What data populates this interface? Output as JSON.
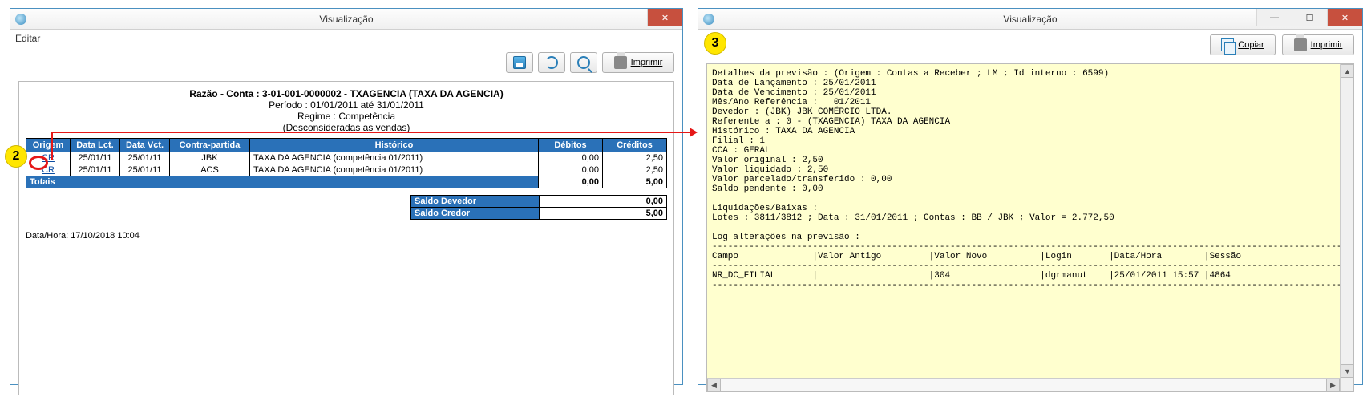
{
  "step_badges": {
    "two": "2",
    "three": "3"
  },
  "left": {
    "title": "Visualização",
    "menu_edit": "Editar",
    "btn_imprimir": "Imprimir",
    "report": {
      "l1": "Razão - Conta : 3-01-001-0000002 - TXAGENCIA (TAXA DA AGENCIA)",
      "l2": "Período : 01/01/2011 até 31/01/2011",
      "l3": "Regime : Competência",
      "l4": "(Desconsideradas as vendas)"
    },
    "cols": {
      "origem": "Origem",
      "data_lct": "Data Lct.",
      "data_vct": "Data Vct.",
      "contra": "Contra-partida",
      "historico": "Histórico",
      "debitos": "Débitos",
      "creditos": "Créditos"
    },
    "rows": [
      {
        "origem": "CR",
        "lct": "25/01/11",
        "vct": "25/01/11",
        "contra": "JBK",
        "hist": "TAXA DA AGENCIA (competência 01/2011)",
        "deb": "0,00",
        "cred": "2,50"
      },
      {
        "origem": "CR",
        "lct": "25/01/11",
        "vct": "25/01/11",
        "contra": "ACS",
        "hist": "TAXA DA AGENCIA (competência 01/2011)",
        "deb": "0,00",
        "cred": "2,50"
      }
    ],
    "totals": {
      "label": "Totais",
      "deb": "0,00",
      "cred": "5,00"
    },
    "balance": {
      "dev_lbl": "Saldo Devedor",
      "dev_val": "0,00",
      "cre_lbl": "Saldo Credor",
      "cre_val": "5,00"
    },
    "footer": "Data/Hora: 17/10/2018 10:04"
  },
  "right": {
    "title": "Visualização",
    "btn_copiar": "Copiar",
    "btn_imprimir": "Imprimir",
    "text": "Detalhes da previsão : (Origem : Contas a Receber ; LM ; Id interno : 6599)\nData de Lançamento : 25/01/2011\nData de Vencimento : 25/01/2011\nMês/Ano Referência :   01/2011\nDevedor : (JBK) JBK COMÉRCIO LTDA.\nReferente a : 0 - (TXAGENCIA) TAXA DA AGENCIA\nHistórico : TAXA DA AGENCIA\nFilial : 1\nCCA : GERAL\nValor original : 2,50\nValor liquidado : 2,50\nValor parcelado/transferido : 0,00\nSaldo pendente : 0,00\n\nLiquidações/Baixas :\nLotes : 3811/3812 ; Data : 31/01/2011 ; Contas : BB / JBK ; Valor = 2.772,50\n\nLog alterações na previsão :\n------------------------------------------------------------------------------------------------------------------------\nCampo              |Valor Antigo         |Valor Novo          |Login       |Data/Hora        |Sessão\n------------------------------------------------------------------------------------------------------------------------\nNR_DC_FILIAL       |                     |304                 |dgrmanut    |25/01/2011 15:57 |4864\n------------------------------------------------------------------------------------------------------------------------"
  },
  "win_buttons": {
    "min": "—",
    "max": "☐",
    "close": "✕"
  }
}
